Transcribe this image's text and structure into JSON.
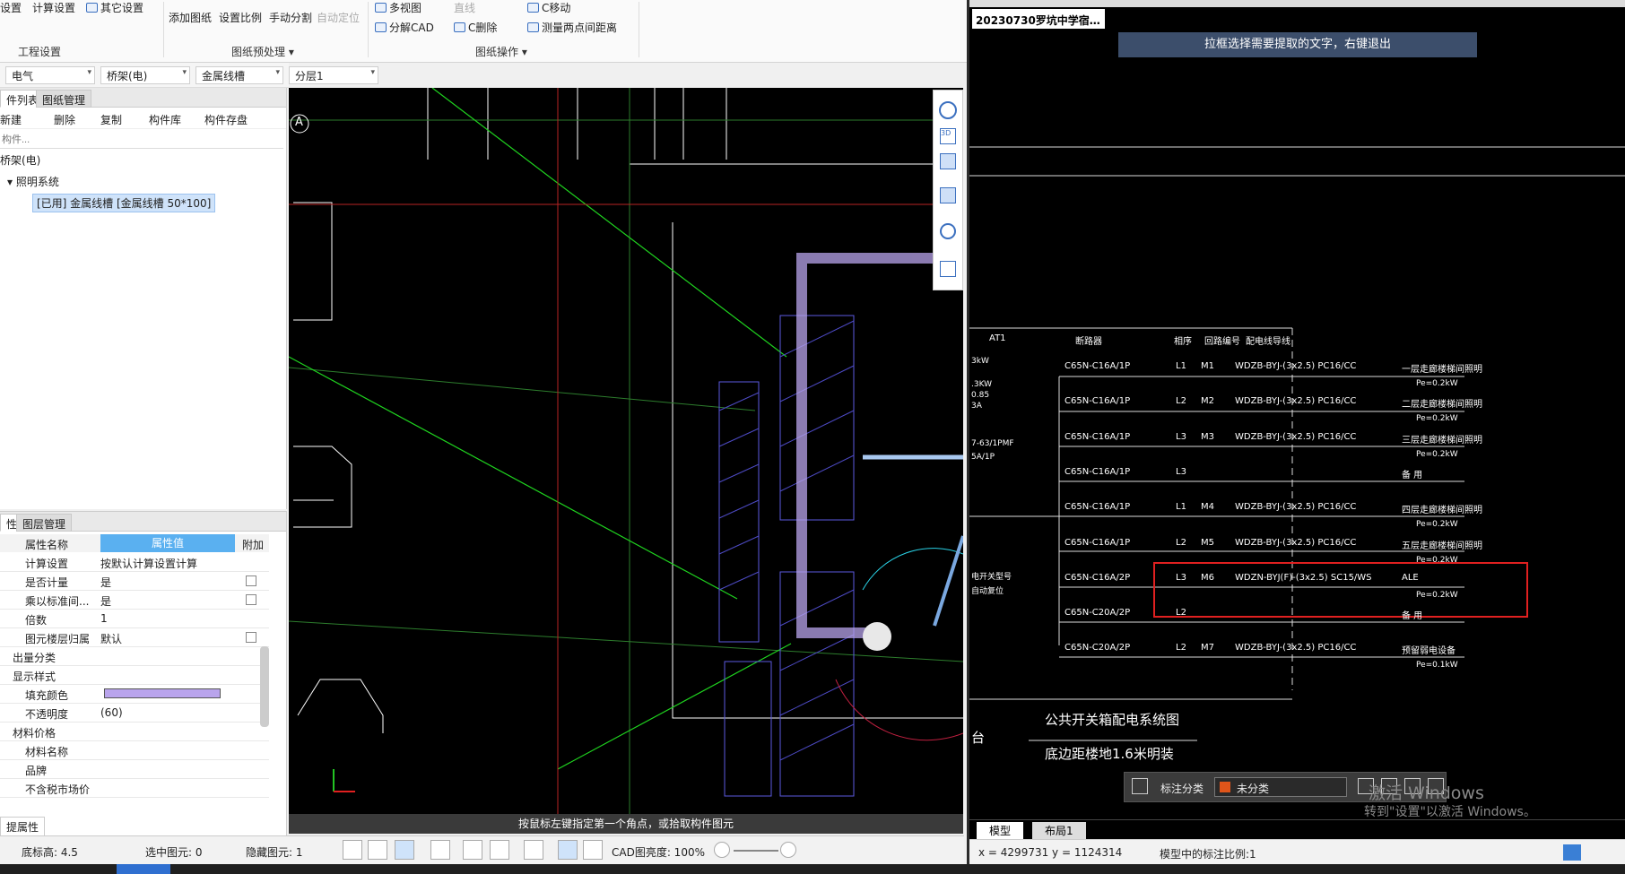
{
  "ribbon": {
    "items": [
      "设置",
      "计算设置",
      "其它设置",
      "添加图纸",
      "设置比例",
      "手动分割",
      "自动定位",
      "多视图",
      "直线",
      "C移动",
      "分解CAD",
      "C删除",
      "测量两点间距离"
    ],
    "groups": [
      "工程设置",
      "图纸预处理 ▾",
      "图纸操作 ▾"
    ]
  },
  "filters": [
    "电气",
    "桥架(电)",
    "金属线槽",
    "分层1"
  ],
  "left": {
    "tabs": [
      "件列表",
      "图纸管理"
    ],
    "toolbar": [
      "新建",
      "删除",
      "复制",
      "构件库",
      "构件存盘"
    ],
    "search_placeholder": "构件...",
    "tree": [
      "桥架(电)",
      "照明系统",
      "[已用] 金属线槽 [金属线槽 50*100]"
    ]
  },
  "props": {
    "tabs": [
      "性",
      "图层管理"
    ],
    "headers": [
      "属性名称",
      "属性值",
      "附加"
    ],
    "rows": [
      {
        "name": "计算设置",
        "value": "按默认计算设置计算"
      },
      {
        "name": "是否计量",
        "value": "是"
      },
      {
        "name": "乘以标准间...",
        "value": "是"
      },
      {
        "name": "倍数",
        "value": "1"
      },
      {
        "name": "图元楼层归属",
        "value": "默认"
      },
      {
        "name": "出量分类",
        "value": ""
      },
      {
        "name": "显示样式",
        "value": ""
      },
      {
        "name": "填充颜色",
        "value": ""
      },
      {
        "name": "不透明度",
        "value": "(60)"
      },
      {
        "name": "材料价格",
        "value": ""
      },
      {
        "name": "材料名称",
        "value": ""
      },
      {
        "name": "品牌",
        "value": ""
      },
      {
        "name": "不含税市场价",
        "value": ""
      }
    ],
    "footer": "提属性",
    "fill_color": "#b9a4ec"
  },
  "canvas": {
    "axis_label": "A",
    "prompt": "按鼠标左键指定第一个角点，或拾取构件图元"
  },
  "status": {
    "height_label": "底标高: 4.5",
    "selected": "选中图元: 0",
    "hidden": "隐藏图元: 1",
    "brightness": "CAD图亮度: 100%"
  },
  "cad": {
    "tab": "20230730罗坑中学宿…",
    "hint": "拉框选择需要提取的文字，右键退出",
    "headers": [
      "AT1",
      "断路器",
      "相序",
      "回路编号",
      "配电线导线"
    ],
    "rows": [
      [
        "C65N-C16A/1P",
        "L1",
        "M1",
        "WDZB-BYJ-(3x2.5) PC16/CC",
        "一层走廊楼梯间照明",
        "Pe=0.2kW"
      ],
      [
        "C65N-C16A/1P",
        "L2",
        "M2",
        "WDZB-BYJ-(3x2.5) PC16/CC",
        "二层走廊楼梯间照明",
        "Pe=0.2kW"
      ],
      [
        "C65N-C16A/1P",
        "L3",
        "M3",
        "WDZB-BYJ-(3x2.5) PC16/CC",
        "三层走廊楼梯间照明",
        "Pe=0.2kW"
      ],
      [
        "C65N-C16A/1P",
        "L3",
        "",
        "",
        "备 用",
        ""
      ],
      [
        "C65N-C16A/1P",
        "L1",
        "M4",
        "WDZB-BYJ-(3x2.5) PC16/CC",
        "四层走廊楼梯间照明",
        "Pe=0.2kW"
      ],
      [
        "C65N-C16A/1P",
        "L2",
        "M5",
        "WDZB-BYJ-(3x2.5) PC16/CC",
        "五层走廊楼梯间照明",
        "Pe=0.2kW"
      ],
      [
        "C65N-C16A/2P",
        "L3",
        "M6",
        "WDZN-BYJ(F)-(3x2.5) SC15/WS",
        "ALE",
        "Pe=0.2kW"
      ],
      [
        "C65N-C20A/2P",
        "L2",
        "",
        "",
        "备 用",
        ""
      ],
      [
        "C65N-C20A/2P",
        "L2",
        "M7",
        "WDZB-BYJ-(3x2.5) PC16/CC",
        "预留弱电设备",
        "Pe=0.1kW"
      ]
    ],
    "left_notes": [
      "3kW",
      ".3KW",
      "0.85",
      "3A",
      "7-63/1PMF",
      "5A/1P",
      "电开关型号",
      "自动复位"
    ],
    "title1": "公共开关箱配电系统图",
    "title2": "底边距楼地1.6米明装",
    "left_char": "台",
    "toolbar_label": "标注分类",
    "category": "未分类",
    "tabs": [
      "模型",
      "布局1"
    ],
    "coords": "x = 4299731  y = 1124314",
    "scale": "模型中的标注比例:1",
    "watermark1": "激活 Windows",
    "watermark2": "转到\"设置\"以激活 Windows。"
  }
}
